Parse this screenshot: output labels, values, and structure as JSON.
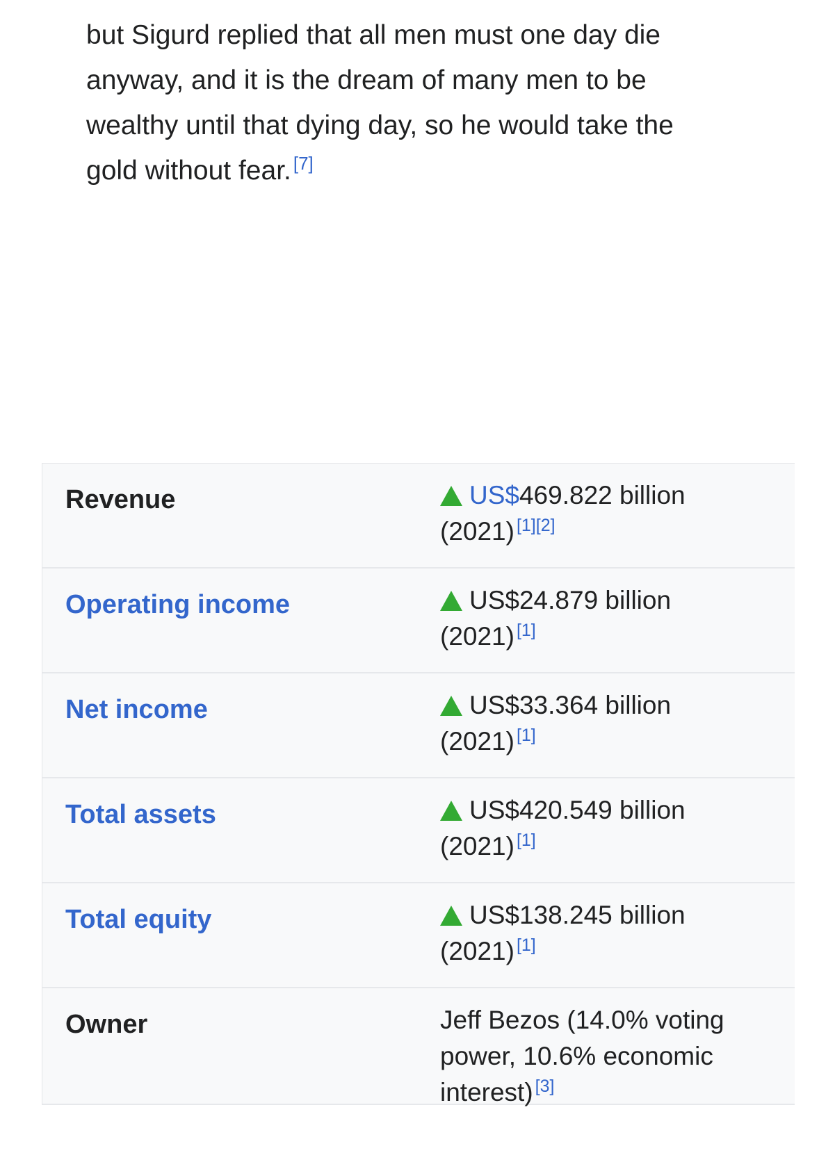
{
  "article": {
    "paragraph_line1": "but Sigurd replied that all men must one day die",
    "paragraph_line2": "anyway, and it is the dream of many men to be",
    "paragraph_line3": "wealthy until that dying day, so he would take the",
    "paragraph_line4": "gold without fear.",
    "paragraph_ref": "[7]"
  },
  "infobox": {
    "rows": [
      {
        "label": "Revenue",
        "value_link": "US$",
        "value_main": "469.822 billion",
        "year": "(2021)",
        "refs": "[1][2]"
      },
      {
        "label": "Operating income",
        "value_main": "US$24.879 billion",
        "year": "(2021)",
        "refs": "[1]"
      },
      {
        "label": "Net income",
        "value_main": "US$33.364 billion",
        "year": "(2021)",
        "refs": "[1]"
      },
      {
        "label": "Total assets",
        "value_main": "US$420.549 billion",
        "year": "(2021)",
        "refs": "[1]"
      },
      {
        "label": "Total equity",
        "value_main": "US$138.245 billion",
        "year": "(2021)",
        "refs": "[1]"
      },
      {
        "label": "Owner",
        "value_line1": "Jeff Bezos (14.0% voting",
        "value_line2": "power, 10.6% economic",
        "value_line3": "interest)",
        "refs": "[3]"
      }
    ]
  },
  "colors": {
    "link": "#3366cc",
    "text": "#202122",
    "increase": "#33aa33",
    "infobox_bg": "#f8f9fa"
  },
  "icons": {
    "increase": "up-triangle-icon"
  }
}
